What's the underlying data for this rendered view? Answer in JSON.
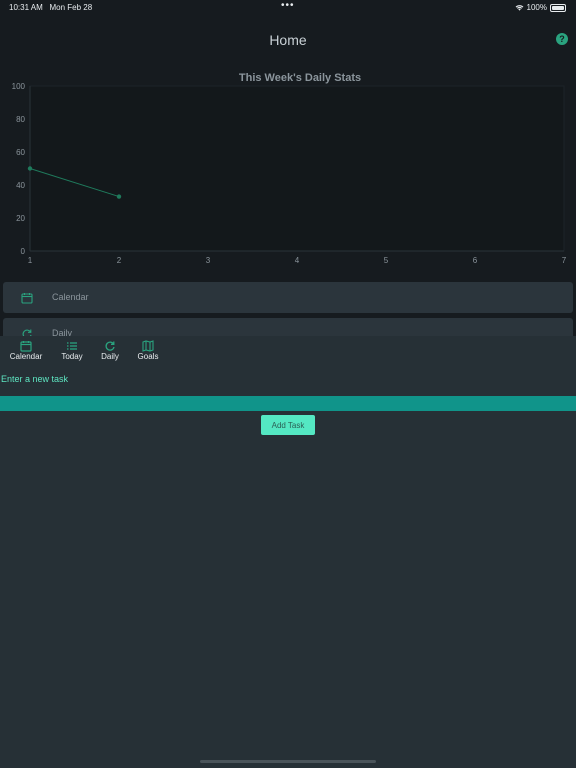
{
  "status_bar": {
    "time": "10:31 AM",
    "date": "Mon Feb 28",
    "dots": "•••",
    "battery": "100%"
  },
  "header": {
    "title": "Home",
    "help_icon": "question-circle-icon",
    "help_glyph": "?"
  },
  "chart_data": {
    "type": "line",
    "title": "This Week's Daily Stats",
    "x": [
      1,
      2
    ],
    "xticks": [
      1,
      2,
      3,
      4,
      5,
      6,
      7
    ],
    "xlim": [
      1,
      7
    ],
    "ylim": [
      0,
      100
    ],
    "yticks": [
      0,
      20,
      40,
      60,
      80,
      100
    ],
    "series": [
      {
        "values": [
          50,
          33
        ],
        "color": "#1f7a5c"
      }
    ],
    "grid": false
  },
  "menu": {
    "items": [
      {
        "label": "Calendar",
        "icon": "calendar-icon"
      },
      {
        "label": "Daily",
        "icon": "refresh-icon"
      }
    ]
  },
  "tabs": [
    {
      "label": "Calendar",
      "icon": "calendar-icon"
    },
    {
      "label": "Today",
      "icon": "list-icon"
    },
    {
      "label": "Daily",
      "icon": "refresh-icon"
    },
    {
      "label": "Goals",
      "icon": "map-icon"
    }
  ],
  "task": {
    "label": "Enter a new task",
    "input_value": "",
    "add_button": "Add Task"
  },
  "colors": {
    "accent": "#2aa37f",
    "input_bg": "#10948a",
    "button_bg": "#54e8c3",
    "background": "#161b1f",
    "panel": "#263036"
  }
}
